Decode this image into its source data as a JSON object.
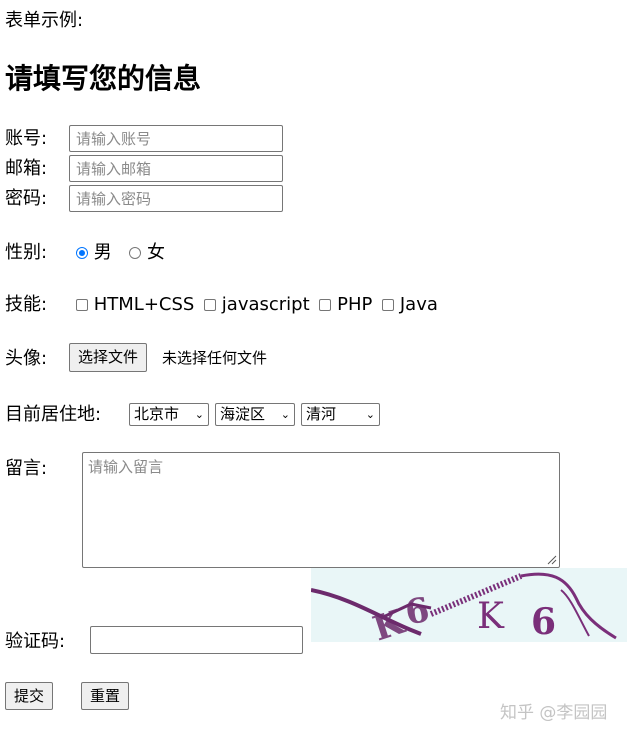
{
  "intro": "表单示例:",
  "title": "请填写您的信息",
  "account": {
    "label": "账号:",
    "placeholder": "请输入账号"
  },
  "email": {
    "label": "邮箱:",
    "placeholder": "请输入邮箱"
  },
  "password": {
    "label": "密码:",
    "placeholder": "请输入密码"
  },
  "gender": {
    "label": "性别:",
    "options": [
      "男",
      "女"
    ],
    "selected": "男"
  },
  "skills": {
    "label": "技能:",
    "options": [
      "HTML+CSS",
      "javascript",
      "PHP",
      "Java"
    ]
  },
  "avatar": {
    "label": "头像:",
    "button": "选择文件",
    "status": "未选择任何文件"
  },
  "location": {
    "label": "目前居住地:",
    "city": "北京市",
    "district": "海淀区",
    "area": "清河"
  },
  "message": {
    "label": "留言:",
    "placeholder": "请输入留言"
  },
  "captcha": {
    "label": "验证码:",
    "image_text": "K6K6",
    "value": ""
  },
  "buttons": {
    "submit": "提交",
    "reset": "重置"
  },
  "watermark": "知乎 @李园园",
  "colors": {
    "radio_accent": "#0075ff",
    "captcha_ink": "#7a2f7a",
    "captcha_bg": "#e9f6f7"
  }
}
